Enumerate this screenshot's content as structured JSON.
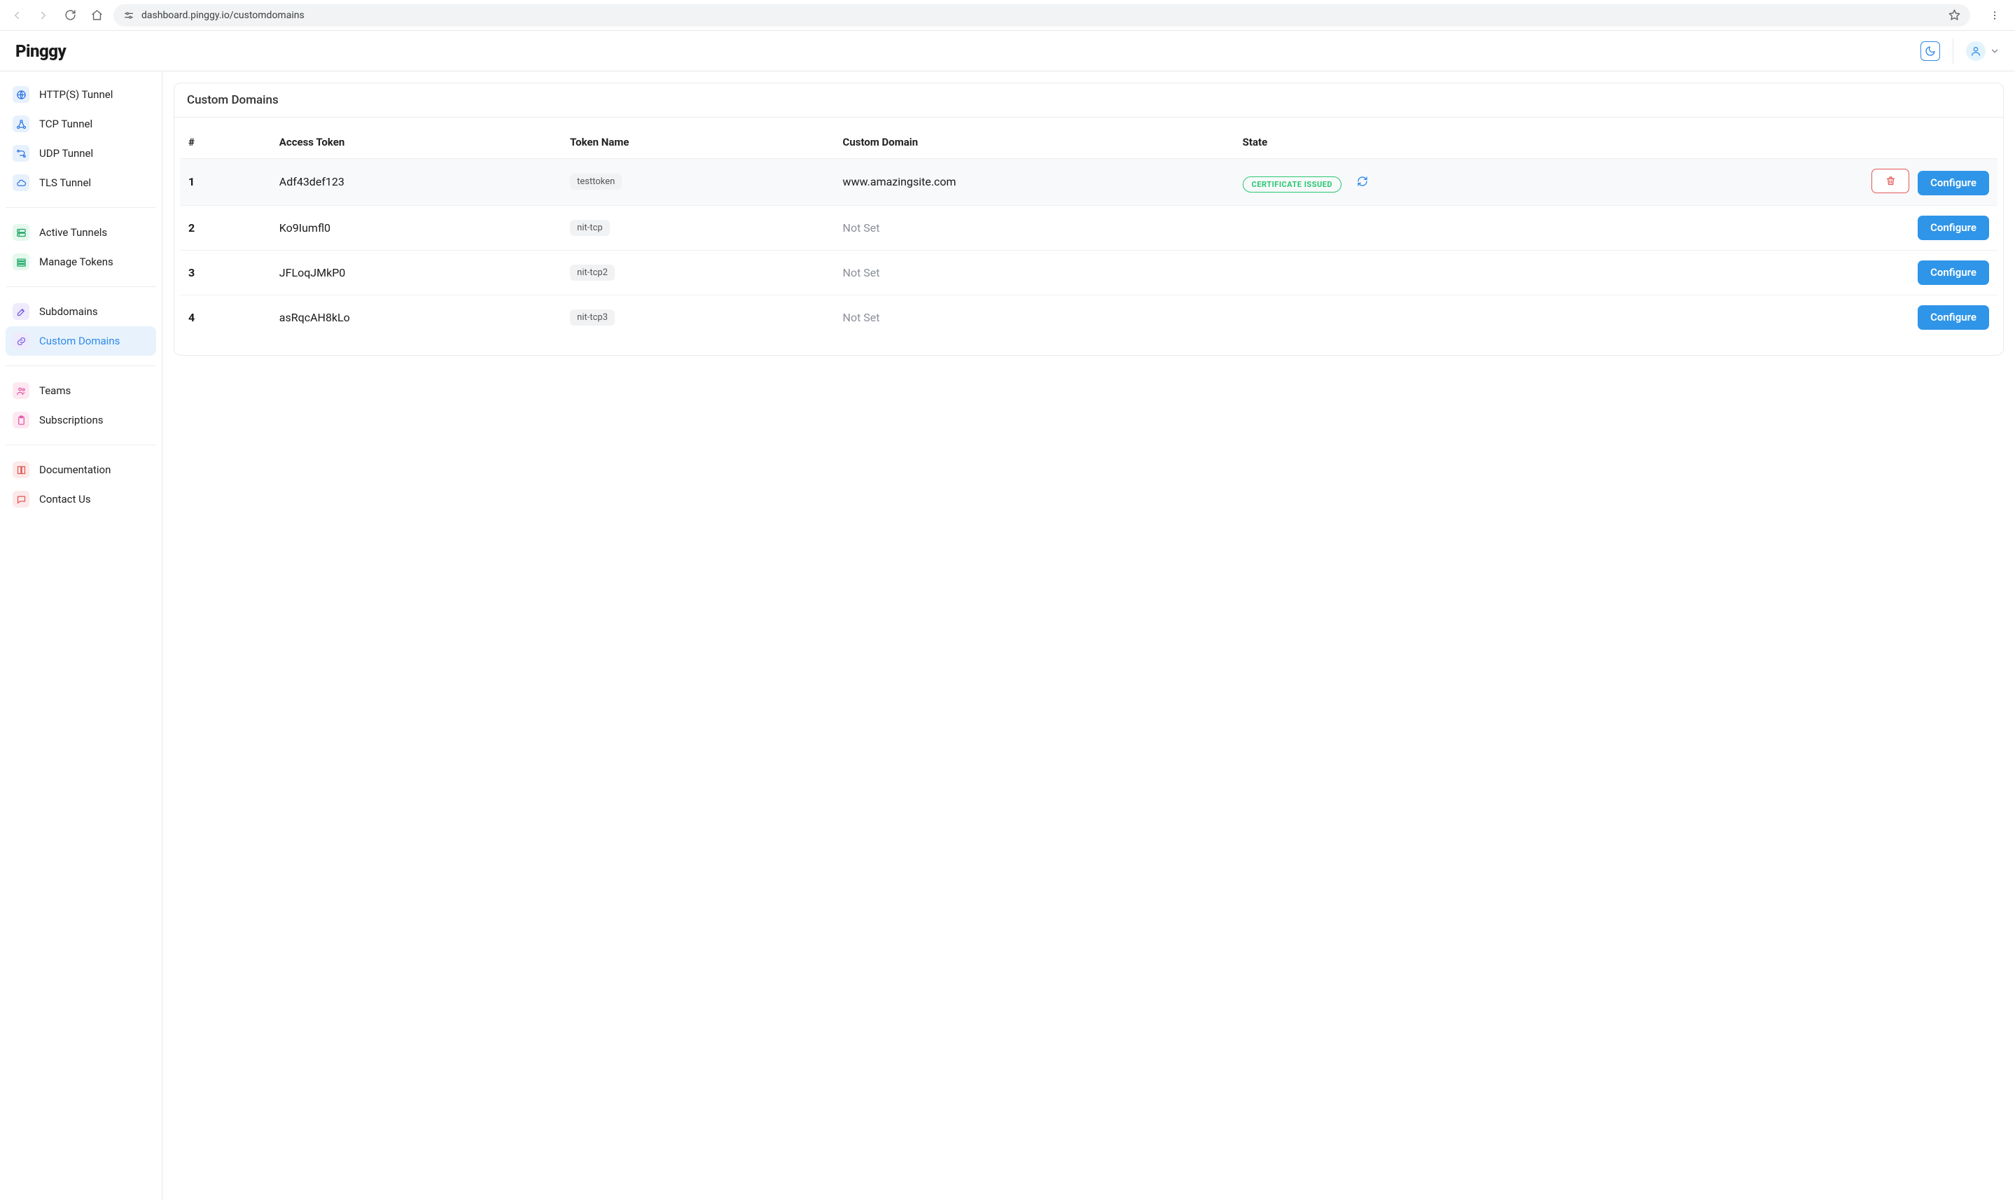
{
  "browser": {
    "url": "dashboard.pinggy.io/customdomains"
  },
  "header": {
    "brand": "Pinggy"
  },
  "sidebar": {
    "groups": [
      {
        "items": [
          {
            "label": "HTTP(S) Tunnel",
            "iconClass": "ic-blue",
            "iconName": "globe-icon",
            "active": false
          },
          {
            "label": "TCP Tunnel",
            "iconClass": "ic-blue",
            "iconName": "network-icon",
            "active": false
          },
          {
            "label": "UDP Tunnel",
            "iconClass": "ic-blue",
            "iconName": "route-icon",
            "active": false
          },
          {
            "label": "TLS Tunnel",
            "iconClass": "ic-blue",
            "iconName": "cloud-lock-icon",
            "active": false
          }
        ]
      },
      {
        "items": [
          {
            "label": "Active Tunnels",
            "iconClass": "ic-green",
            "iconName": "server-icon",
            "active": false
          },
          {
            "label": "Manage Tokens",
            "iconClass": "ic-green",
            "iconName": "list-icon",
            "active": false
          }
        ]
      },
      {
        "items": [
          {
            "label": "Subdomains",
            "iconClass": "ic-purple",
            "iconName": "pencil-icon",
            "active": false
          },
          {
            "label": "Custom Domains",
            "iconClass": "ic-purple",
            "iconName": "link-icon",
            "active": true
          }
        ]
      },
      {
        "items": [
          {
            "label": "Teams",
            "iconClass": "ic-pink",
            "iconName": "group-icon",
            "active": false
          },
          {
            "label": "Subscriptions",
            "iconClass": "ic-pink",
            "iconName": "clipboard-icon",
            "active": false
          }
        ]
      },
      {
        "items": [
          {
            "label": "Documentation",
            "iconClass": "ic-red",
            "iconName": "book-icon",
            "active": false
          },
          {
            "label": "Contact Us",
            "iconClass": "ic-red",
            "iconName": "message-icon",
            "active": false
          }
        ]
      }
    ]
  },
  "page": {
    "title": "Custom Domains",
    "configure_label": "Configure",
    "not_set_label": "Not Set",
    "columns": {
      "index": "#",
      "access_token": "Access Token",
      "token_name": "Token Name",
      "custom_domain": "Custom Domain",
      "state": "State"
    },
    "rows": [
      {
        "idx": "1",
        "access_token": "Adf43def123",
        "token_name": "testtoken",
        "custom_domain": "www.amazingsite.com",
        "state": "CERTIFICATE ISSUED",
        "has_domain": true,
        "show_trash": true,
        "hovered": true
      },
      {
        "idx": "2",
        "access_token": "Ko9Iumfl0",
        "token_name": "nit-tcp",
        "custom_domain": "",
        "state": "",
        "has_domain": false,
        "show_trash": false,
        "hovered": false
      },
      {
        "idx": "3",
        "access_token": "JFLoqJMkP0",
        "token_name": "nit-tcp2",
        "custom_domain": "",
        "state": "",
        "has_domain": false,
        "show_trash": false,
        "hovered": false
      },
      {
        "idx": "4",
        "access_token": "asRqcAH8kLo",
        "token_name": "nit-tcp3",
        "custom_domain": "",
        "state": "",
        "has_domain": false,
        "show_trash": false,
        "hovered": false
      }
    ]
  }
}
